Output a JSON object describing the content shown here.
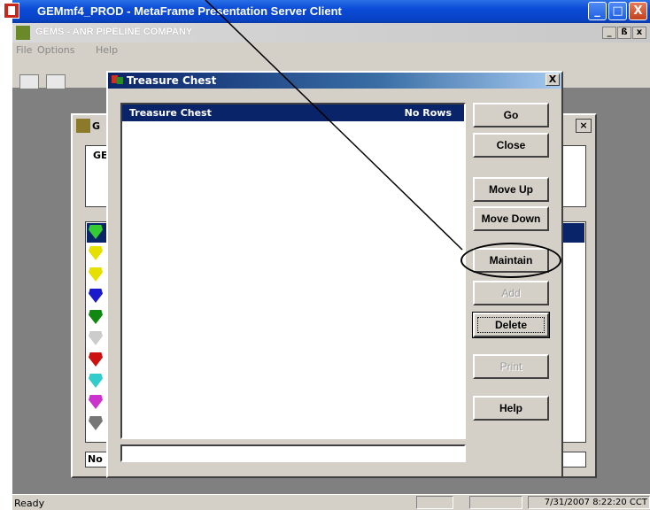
{
  "outer_window": {
    "title": "GEMmf4_PROD - MetaFrame Presentation Server Client",
    "controls": [
      "_",
      "□",
      "X"
    ]
  },
  "app": {
    "title": "GEMS - ANR PIPELINE COMPANY",
    "mdi_controls": [
      "_",
      "ß",
      "x"
    ],
    "menu": [
      "File",
      "Options",
      "Help"
    ]
  },
  "background_window": {
    "title": "G",
    "text_label": "GE",
    "status_text": "No"
  },
  "dialog": {
    "title": "Treasure Chest",
    "close_label": "X",
    "list_header": {
      "left": "Treasure Chest",
      "right": "No Rows"
    },
    "buttons": {
      "go": "Go",
      "close": "Close",
      "move_up": "Move Up",
      "move_down": "Move Down",
      "maintain": "Maintain",
      "add": "Add",
      "delete": "Delete",
      "print": "Print",
      "help": "Help"
    }
  },
  "gem_colors": [
    "#33cc33",
    "#e6e000",
    "#e6e000",
    "#1a1acc",
    "#118811",
    "#cccccc",
    "#cc1111",
    "#33cccc",
    "#cc33cc",
    "#777777"
  ],
  "status_bar": {
    "left": "Ready",
    "right": "7/31/2007 8:22:20 CCT"
  }
}
